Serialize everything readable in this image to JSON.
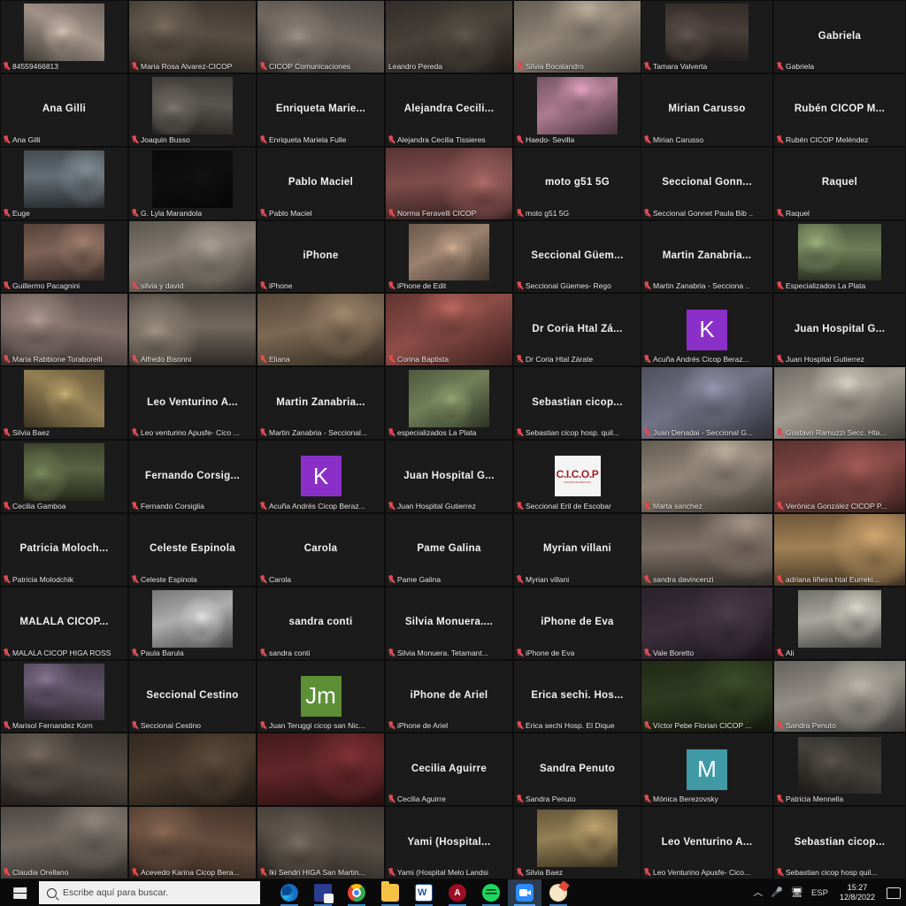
{
  "meeting": {
    "app": "zoom-gallery-view",
    "speaking_border_color": "#d7ef4a",
    "muted_icon_color": "#d8434a"
  },
  "main_grid": {
    "columns": 5,
    "rows": 12,
    "tiles": [
      {
        "name": "84559466813",
        "label": "84559466813",
        "video": true,
        "inset": true,
        "muted": true,
        "tone": "#c9b7aa"
      },
      {
        "name": "Maria Rosa Alvarez-CICOP",
        "label": "Maria Rosa Alvarez-CICOP",
        "video": true,
        "muted": true,
        "tone": "#6d6154"
      },
      {
        "name": "CICOP Comunicaciones",
        "label": "CICOP Comunicaciones",
        "video": true,
        "muted": true,
        "tone": "#8c8178"
      },
      {
        "name": "Leandro Pereda",
        "label": "Leandro Pereda",
        "video": true,
        "muted": false,
        "speaking": true,
        "tone": "#5a5148"
      },
      {
        "name": "Silvia Bocalandro",
        "label": "Silvia Bocalandro",
        "video": true,
        "muted": true,
        "tone": "#b5a795"
      },
      {
        "name": "Ana Gilli",
        "label": "Ana Gilli",
        "video": false,
        "muted": true
      },
      {
        "name": "Joaquin Busso",
        "label": "Joaquin Busso",
        "video": true,
        "inset": true,
        "muted": true,
        "tone": "#6f6a63"
      },
      {
        "name": "Enriqueta Mariela Fulle",
        "label": "Enriqueta Mariela Fulle",
        "display": "Enriqueta  Marie...",
        "video": false,
        "muted": true
      },
      {
        "name": "Alejandra Cecilia Tissieres",
        "label": "Alejandra Cecilia Tissieres",
        "display": "Alejandra  Cecili...",
        "video": false,
        "muted": true
      },
      {
        "name": "Haedo- Sevilla",
        "label": "Haedo- Sevilla",
        "video": true,
        "inset": true,
        "muted": true,
        "tone": "#d79ab4"
      },
      {
        "name": "Euge",
        "label": "Euge",
        "video": true,
        "inset": true,
        "muted": true,
        "tone": "#7d8a93"
      },
      {
        "name": "G. Lyla Marandola",
        "label": "G. Lyla Marandola",
        "video": true,
        "inset": true,
        "muted": true,
        "tone": "#121212"
      },
      {
        "name": "Pablo Maciel",
        "label": "Pablo Maciel",
        "display": "Pablo Maciel",
        "video": false,
        "muted": true
      },
      {
        "name": "Norma Feravelli CICOP",
        "label": "Norma Feravelli CICOP",
        "video": true,
        "muted": true,
        "tone": "#9c5f5c"
      },
      {
        "name": "moto g51 5G",
        "label": "moto g51 5G",
        "display": "moto g51 5G",
        "video": false,
        "muted": true
      },
      {
        "name": "Guillermo Pacagnini",
        "label": "Guillermo Pacagnini",
        "video": true,
        "inset": true,
        "muted": true,
        "tone": "#9d7a6b"
      },
      {
        "name": "silvia y david",
        "label": "silvia y david",
        "video": true,
        "muted": true,
        "tone": "#a79c90"
      },
      {
        "name": "iPhone",
        "label": "iPhone",
        "display": "iPhone",
        "video": false,
        "muted": true
      },
      {
        "name": "iPhone de Edit",
        "label": "iPhone de Edit",
        "video": true,
        "inset": true,
        "muted": true,
        "tone": "#c2a189"
      },
      {
        "name": "Seccional Guemes- Rego",
        "label": "Seccional Güemes- Rego",
        "display": "Seccional  Güem...",
        "video": false,
        "muted": true
      },
      {
        "name": "Maria Rabbione Toraborelli",
        "label": "Maria Rabbione Toraborelli",
        "video": true,
        "muted": true,
        "tone": "#a08a84"
      },
      {
        "name": "Alfredo Bisonni",
        "label": "Alfredo Bisonni",
        "video": true,
        "muted": true,
        "tone": "#8f8376"
      },
      {
        "name": "Eliana",
        "label": "Eliana",
        "video": true,
        "muted": true,
        "tone": "#9b8268"
      },
      {
        "name": "Corina Baptista",
        "label": "Corina Baptista",
        "video": true,
        "muted": true,
        "tone": "#b06059"
      },
      {
        "name": "Dr Coria Htal Zarate",
        "label": "Dr Coria Htal Zárate",
        "display": "Dr Coria Htal Zá...",
        "video": false,
        "muted": true
      },
      {
        "name": "Silvia Baez",
        "label": "Silvia Baez",
        "video": true,
        "inset": true,
        "muted": true,
        "tone": "#b9a06a"
      },
      {
        "name": "Leo Venturino Apuafe- Cicop",
        "label": "Leo venturino Apusfe- Cico ...",
        "display": "Leo Venturino A...",
        "video": false,
        "muted": true
      },
      {
        "name": "Martin Zanabria - Seccional",
        "label": "Martin Zanabria - Seccional...",
        "display": "Martin Zanabria...",
        "video": false,
        "muted": true
      },
      {
        "name": "especializados La Plata",
        "label": "especializados La Plata",
        "video": true,
        "inset": true,
        "muted": true,
        "tone": "#8ea06f"
      },
      {
        "name": "Sebastian cicop hosp quil",
        "label": "Sebastian  cicop hosp. quil...",
        "display": "Sebastian   cicop...",
        "video": false,
        "muted": true
      },
      {
        "name": "Cecilia Gamboa",
        "label": "Cecilia Gamboa",
        "video": true,
        "inset": true,
        "muted": true,
        "tone": "#6f7a52"
      },
      {
        "name": "Fernando Corsiglia",
        "label": "Fernando Corsiglia",
        "display": "Fernando  Corsig...",
        "video": false,
        "muted": true
      },
      {
        "name": "Acuna Andres Cicop Beraz",
        "label": "Acuña Andrés Cicop Beraz...",
        "avatar": "K",
        "avatar_color": "#8b2fc9",
        "muted": true
      },
      {
        "name": "Juan Hospital Gutierrez",
        "label": "Juan Hospital Gutierrez",
        "display": "Juan Hospital G...",
        "video": false,
        "muted": true
      },
      {
        "name": "Seccional Eril de Escobar",
        "label": "Seccional Eril  de Escobar",
        "logo": "CICOP",
        "muted": true
      },
      {
        "name": "Patricia Molodchik",
        "label": "Patricia Molodchik",
        "display": "Patricia  Moloch...",
        "video": false,
        "muted": true
      },
      {
        "name": "Celeste Espinola",
        "label": "Celeste Espinola",
        "display": "Celeste Espinola",
        "video": false,
        "muted": true
      },
      {
        "name": "Carola",
        "label": "Carola",
        "display": "Carola",
        "video": false,
        "muted": true
      },
      {
        "name": "Pame Galina",
        "label": "Pame Galina",
        "display": "Pame Galina",
        "video": false,
        "muted": true
      },
      {
        "name": "Myrian villani",
        "label": "Myrian villani",
        "display": "Myrian villani",
        "video": false,
        "muted": true
      },
      {
        "name": "MALALA CICOP HIGA ROSS",
        "label": "MALALA CICOP HIGA ROSS",
        "display": "MALALA  CICOP...",
        "video": false,
        "muted": true
      },
      {
        "name": "Paula Barula",
        "label": "Paula Barula",
        "video": true,
        "inset": true,
        "muted": true,
        "tone": "#d8d8d8"
      },
      {
        "name": "sandra conti",
        "label": "sandra conti",
        "display": "sandra conti",
        "video": false,
        "muted": true
      },
      {
        "name": "Silvia Monuera Tetamanti",
        "label": "Silvia Monuera. Tetamant...",
        "display": "Silvia  Monuera....",
        "video": false,
        "muted": true
      },
      {
        "name": "iPhone de Eva",
        "label": "iPhone de Eva",
        "display": "iPhone de Eva",
        "video": false,
        "muted": true
      },
      {
        "name": "Marisol Fernandez Korn",
        "label": "Marisol Fernandez Korn",
        "video": true,
        "inset": true,
        "muted": true,
        "tone": "#7a6a84"
      },
      {
        "name": "Seccional Cestino",
        "label": "Seccional Cestino",
        "display": "Seccional Cestino",
        "video": false,
        "muted": true
      },
      {
        "name": "Juan Teruggi cicop san Nic",
        "label": "Juan Teruggi cicop san Nic...",
        "avatar": "Jm",
        "avatar_color": "#5d8f37",
        "muted": true
      },
      {
        "name": "iPhone de Ariel",
        "label": "iPhone de Ariel",
        "display": "iPhone de Ariel",
        "video": false,
        "muted": true
      },
      {
        "name": "Erica sechi Hosp El Dique",
        "label": "Erica sechi Hosp. El Dique",
        "display": "Erica sechi. Hos...",
        "video": false,
        "muted": true
      },
      {
        "name": "unnamed-participant-a",
        "label": "",
        "video": true,
        "muted": false,
        "tone": "#6a5f56"
      },
      {
        "name": "unnamed-participant-b",
        "label": "",
        "video": true,
        "muted": false,
        "tone": "#5c4a3a"
      },
      {
        "name": "unnamed-participant-c",
        "label": "",
        "video": true,
        "muted": false,
        "tone": "#7b2f33"
      },
      {
        "name": "Cecilia Aguirre",
        "label": "Cecilia Aguirre",
        "display": "Cecilia Aguirre",
        "video": false,
        "muted": true
      },
      {
        "name": "Sandra Penuto",
        "label": "Sandra Penuto",
        "display": "Sandra Penuto",
        "video": false,
        "muted": true
      },
      {
        "name": "Claudia Orellano",
        "label": "Claudia Orellano",
        "video": true,
        "muted": true,
        "tone": "#8d8279"
      },
      {
        "name": "Acevedo Karina Cicop Bera",
        "label": "Acevedo Karina Cicop Bera...",
        "video": true,
        "muted": true,
        "tone": "#7e5f4c"
      },
      {
        "name": "Iki Sendri HIGA San Martin",
        "label": "Iki Sendri HIGA San Martin...",
        "video": true,
        "muted": true,
        "tone": "#6d6257"
      },
      {
        "name": "Yami Hospital Melo Landsi",
        "label": "Yami (Hospital Melo Landsi",
        "display": "Yami  (Hospital...",
        "video": false,
        "muted": true
      },
      {
        "name": "Silvia Baez 2",
        "label": "Silvia Baez",
        "video": true,
        "inset": true,
        "muted": true,
        "tone": "#b9a06a"
      }
    ]
  },
  "side_grid": {
    "columns": 2,
    "rows": 12,
    "tiles": [
      {
        "name": "Tamara Valverta",
        "label": "Tamara Valverta",
        "video": true,
        "inset": true,
        "muted": true,
        "tone": "#5a4e48"
      },
      {
        "name": "Gabriela",
        "label": "Gabriela",
        "display": "Gabriela",
        "video": false,
        "muted": true
      },
      {
        "name": "Mirian Carusso",
        "label": "Mirian Carusso",
        "display": "Mirian Carusso",
        "video": false,
        "muted": true
      },
      {
        "name": "Ruben CICOP Melendez",
        "label": "Rubén CICOP Meléndez",
        "display": "Rubén CICOP M...",
        "video": false,
        "muted": true
      },
      {
        "name": "Seccional Gonnet Paula Bib",
        "label": "Seccional  Gonnet Paula Bib ..",
        "display": "Seccional  Gonn...",
        "video": false,
        "muted": true
      },
      {
        "name": "Raquel",
        "label": "Raquel",
        "display": "Raquel",
        "video": false,
        "muted": true
      },
      {
        "name": "Martin Zanabria - Seccional side",
        "label": "Martin Zanabria - Secciona ..",
        "display": "Martin  Zanabria...",
        "video": false,
        "muted": true
      },
      {
        "name": "Especializados La Plata",
        "label": "Especializados La Plata",
        "video": true,
        "inset": true,
        "muted": true,
        "tone": "#8a9d6e"
      },
      {
        "name": "Acuna Andres Cicop Beraz side",
        "label": "Acuña Andrés Cicop Beraz...",
        "avatar": "K",
        "avatar_color": "#8b2fc9",
        "muted": true
      },
      {
        "name": "Juan Hospital Gutierrez side",
        "label": "Juan Hospital Gutierrez",
        "display": "Juan Hospital G...",
        "video": false,
        "muted": true
      },
      {
        "name": "Juan Denadai - Seccional G",
        "label": "Juan Denadai - Seccional G...",
        "video": true,
        "muted": true,
        "tone": "#8f90a8"
      },
      {
        "name": "Gustavo Ramuzzi Secc Htal",
        "label": "Gustavo Ramuzzi Secc. Hta...",
        "video": true,
        "muted": true,
        "tone": "#c9c2b5"
      },
      {
        "name": "Marta sanchez",
        "label": "Marta sanchez",
        "video": true,
        "muted": true,
        "tone": "#b6a896"
      },
      {
        "name": "Veronica Gonzalez CICOP P",
        "label": "Verónica González CICOP P...",
        "video": true,
        "muted": true,
        "tone": "#a35a55"
      },
      {
        "name": "sandra davincenzi",
        "label": "sandra davincenzi",
        "video": true,
        "muted": true,
        "tone": "#9e8d80"
      },
      {
        "name": "adriana lineira htal Eurreki",
        "label": "adriana liñeira  htal Eurreki...",
        "video": true,
        "muted": true,
        "tone": "#c9a06a"
      },
      {
        "name": "Vale Boretto",
        "label": "Vale Boretto",
        "video": true,
        "muted": true,
        "tone": "#4a3b4a"
      },
      {
        "name": "Ali",
        "label": "Ali",
        "video": true,
        "inset": true,
        "muted": true,
        "tone": "#cfcfc4"
      },
      {
        "name": "Victor Pebe Florian CICOP",
        "label": "Víctor Pebe Florian CICOP ...",
        "video": true,
        "muted": true,
        "tone": "#3a4a28"
      },
      {
        "name": "Sandra Penuto side",
        "label": "Sandra Penuto",
        "video": true,
        "muted": true,
        "tone": "#b7b2a8"
      },
      {
        "name": "Monica Berezovsky",
        "label": "Mónica Berezovsky",
        "avatar": "M",
        "avatar_color": "#3f9aa6",
        "muted": true
      },
      {
        "name": "Patricia Mennella",
        "label": "Patricia Mennella",
        "video": true,
        "inset": true,
        "muted": true,
        "tone": "#55504a"
      },
      {
        "name": "Leo Venturino Apusfe- Cicop side",
        "label": "Leo Venturino Apusfe- Cico...",
        "display": "Leo Venturino A...",
        "video": false,
        "muted": true
      },
      {
        "name": "Sebastian cicop hosp quil side",
        "label": "Sebastian  cicop hosp  quil...",
        "display": "Sebastian   cicop...",
        "video": false,
        "muted": true
      }
    ]
  },
  "taskbar": {
    "start_label": "Start",
    "search_placeholder": "Escribe aquí para buscar.",
    "apps": [
      {
        "name": "edge",
        "label": "Microsoft Edge",
        "state": "open"
      },
      {
        "name": "file-transfer",
        "label": "File Transfer",
        "state": "open"
      },
      {
        "name": "chrome",
        "label": "Google Chrome",
        "state": "open"
      },
      {
        "name": "file-explorer",
        "label": "Explorador de archivos",
        "state": "open"
      },
      {
        "name": "word",
        "label": "Word",
        "state": "open"
      },
      {
        "name": "red-app",
        "label": "Aplicación",
        "state": "open"
      },
      {
        "name": "spotify",
        "label": "Spotify",
        "state": "open"
      },
      {
        "name": "zoom",
        "label": "Zoom",
        "state": "active"
      },
      {
        "name": "paint",
        "label": "Paint",
        "state": "open"
      }
    ],
    "tray": {
      "chevron": "︿",
      "mic": "mic-icon",
      "network": "network-icon",
      "language": "ESP",
      "time": "15:27",
      "date": "12/8/2022",
      "action_center": "action-center-icon"
    }
  }
}
